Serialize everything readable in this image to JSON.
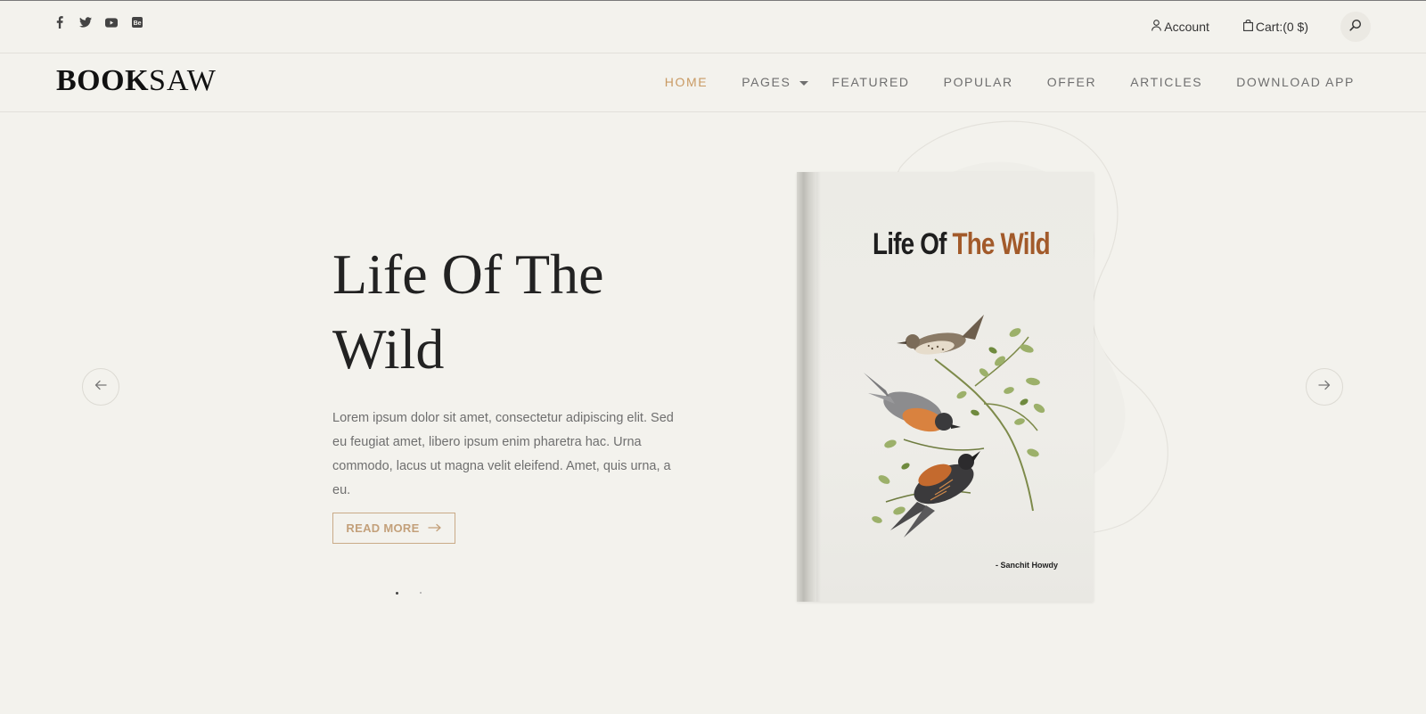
{
  "topbar": {
    "social": [
      {
        "name": "facebook-icon"
      },
      {
        "name": "twitter-icon"
      },
      {
        "name": "youtube-icon"
      },
      {
        "name": "behance-icon"
      }
    ],
    "account_label": "Account",
    "cart_label": "Cart:(0 $)"
  },
  "header": {
    "logo_bold": "BOOK",
    "logo_light": "SAW",
    "nav": [
      {
        "label": "HOME",
        "active": true
      },
      {
        "label": "PAGES",
        "dropdown": true
      },
      {
        "label": "FEATURED"
      },
      {
        "label": "POPULAR"
      },
      {
        "label": "OFFER"
      },
      {
        "label": "ARTICLES"
      },
      {
        "label": "DOWNLOAD APP"
      }
    ]
  },
  "hero": {
    "title": "Life Of The Wild",
    "description": "Lorem ipsum dolor sit amet, consectetur adipiscing elit. Sed eu feugiat amet, libero ipsum enim pharetra hac. Urna commodo, lacus ut magna velit eleifend. Amet, quis urna, a eu.",
    "read_more_label": "READ MORE",
    "slides": 2,
    "active_slide": 1
  },
  "book": {
    "title_dark": "Life Of",
    "title_brown": "The Wild",
    "author": "- Sanchit Howdy"
  },
  "colors": {
    "background": "#f3f2ed",
    "accent": "#c99a63",
    "book_title_accent": "#a25a2a",
    "button_border": "#c9aa87"
  }
}
